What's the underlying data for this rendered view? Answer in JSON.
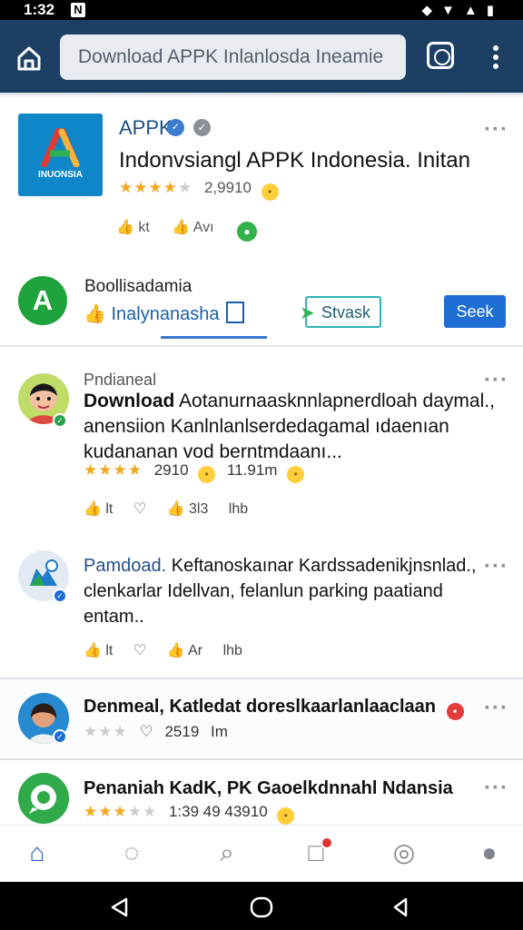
{
  "status_bar": {
    "time": "1:32",
    "notification_icon": "N",
    "system_icons": [
      "vpn-icon",
      "wifi-icon",
      "signal-icon",
      "battery-icon"
    ]
  },
  "browser": {
    "url_text": "Download APPK Inlanlosda Ineamie"
  },
  "app_card": {
    "logo_text": "INUONSIA",
    "name": "APPK",
    "title": "Indonvsiangl APPK Indonesia. Initan",
    "rating": "2,9910",
    "stars_on": "★★★★",
    "stars_off": "★",
    "reactions": [
      "👍 kt",
      "👍 Avı"
    ],
    "seller_name": "Boollisadamia",
    "like_link": "Inalynanasha",
    "install_button": "Stvask",
    "seek_button": "Seek"
  },
  "posts": [
    {
      "label": "Pndianeal",
      "lead": "Download",
      "text_lines": [
        "Aotanurnaasknnlapnerdloah daymal.,",
        "anensiion Kanlnlanlserdedagamal ıdaenıan",
        "kudananan vod berntmdaanı..."
      ],
      "stars_on": "★★★★",
      "rating": "2910",
      "extra": "11.91m",
      "reactions": [
        "👍 lt",
        "♡",
        "👍 3l3",
        "lhb"
      ]
    },
    {
      "lead": "Pamdoad.",
      "text_lines": [
        "Keftanoskaınar Kardssadenikjnsnlad.,",
        "clenkarlar Idellvan, felanlun parking paatiand",
        "entam.."
      ],
      "reactions": [
        "👍 lt",
        "♡",
        "👍 Ar",
        "lhb"
      ]
    },
    {
      "lead": "Denmeal,",
      "text": "Katledat doreslkaarlanlaaclaan",
      "stars_off": "★★★",
      "heart": "♡",
      "rating": "2519",
      "extra": "Im"
    },
    {
      "text": "Penaniah KadK, PK Gaoelkdnnahl Ndansia",
      "stars_on": "★★★",
      "stars_off": "★★",
      "rating": "1:39 49 43910"
    }
  ],
  "bottom_nav": {
    "items": [
      "home-icon",
      "search-icon",
      "search-icon-2",
      "notifications-icon",
      "verified-icon",
      "profile-icon"
    ]
  },
  "colors": {
    "app_bar": "#1c3f63",
    "accent": "#1f6ed3",
    "star": "#f0a922"
  }
}
